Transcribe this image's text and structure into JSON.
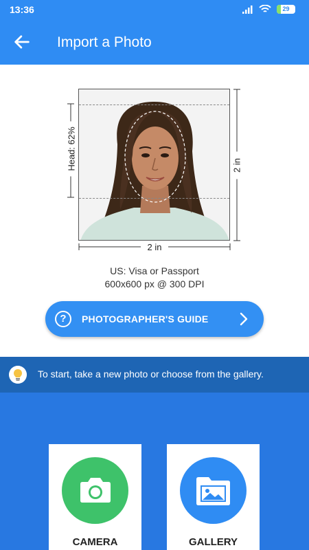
{
  "status_bar": {
    "time": "13:36",
    "battery": "29"
  },
  "app_bar": {
    "title": "Import a Photo"
  },
  "photo": {
    "head_label": "Head: 62%",
    "height_label": "2 in",
    "width_label": "2 in"
  },
  "caption": {
    "line1": "US: Visa or Passport",
    "line2": "600x600 px @ 300 DPI"
  },
  "guide_button": {
    "label": "PHOTOGRAPHER'S GUIDE"
  },
  "tip": {
    "text": "To start, take a new photo or choose from the gallery."
  },
  "sources": {
    "camera_label": "CAMERA",
    "gallery_label": "GALLERY"
  },
  "colors": {
    "primary": "#2f8cf3",
    "tip_bar": "#1e65b4",
    "bottom_bg": "#2878e1",
    "camera_circle": "#3ec26a",
    "gallery_circle": "#2f8cf3"
  }
}
